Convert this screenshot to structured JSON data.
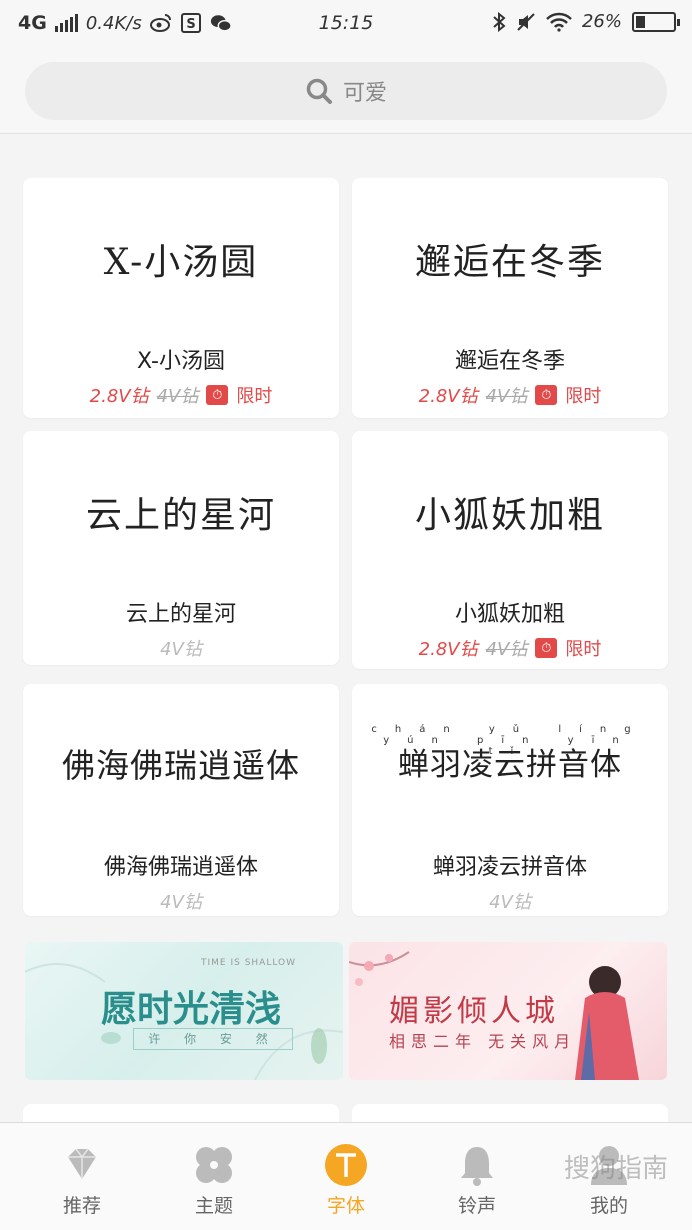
{
  "status_bar": {
    "network": "4G",
    "speed": "0.4K/s",
    "time": "15:15",
    "battery": "26%",
    "battery_level": 0.26
  },
  "search": {
    "placeholder": "可爱"
  },
  "fonts": [
    {
      "preview": "X-小汤圆",
      "name": "X-小汤圆",
      "sale_price": "2.8V钻",
      "original_price": "4V钻",
      "badge": "限时",
      "on_sale": true
    },
    {
      "preview": "邂逅在冬季",
      "name": "邂逅在冬季",
      "sale_price": "2.8V钻",
      "original_price": "4V钻",
      "badge": "限时",
      "on_sale": true
    },
    {
      "preview": "云上的星河",
      "name": "云上的星河",
      "price": "4V钻",
      "on_sale": false
    },
    {
      "preview": "小狐妖加粗",
      "name": "小狐妖加粗",
      "sale_price": "2.8V钻",
      "original_price": "4V钻",
      "badge": "限时",
      "on_sale": true
    },
    {
      "preview": "佛海佛瑞逍遥体",
      "name": "佛海佛瑞逍遥体",
      "price": "4V钻",
      "on_sale": false
    },
    {
      "preview": "蝉羽凌云拼音体",
      "preview_pinyin": "chán yǔ líng yún pīn yīn tǐ",
      "name": "蝉羽凌云拼音体",
      "price": "4V钻",
      "on_sale": false
    }
  ],
  "banners": [
    {
      "title": "愿时光清浅",
      "english": "TIME IS SHALLOW",
      "subtitle": "许 你 安 然"
    },
    {
      "title": "媚影倾人城",
      "subtitle": "相思二年 无关风月"
    }
  ],
  "bottom_nav": [
    {
      "label": "推荐",
      "icon": "diamond-icon",
      "active": false
    },
    {
      "label": "主题",
      "icon": "pinwheel-icon",
      "active": false
    },
    {
      "label": "字体",
      "icon": "font-t-icon",
      "active": true
    },
    {
      "label": "铃声",
      "icon": "bell-icon",
      "active": false
    },
    {
      "label": "我的",
      "icon": "person-icon",
      "active": false
    }
  ],
  "watermark": "搜狗指南",
  "colors": {
    "accent": "#f5a623",
    "sale": "#e24a4a",
    "background": "#f4f4f4"
  }
}
